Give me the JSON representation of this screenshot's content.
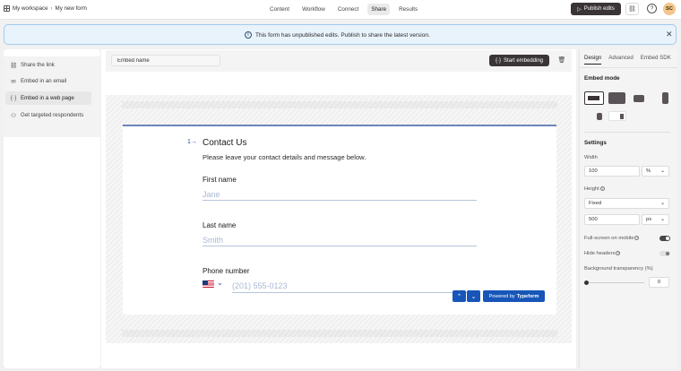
{
  "topbar": {
    "workspace": "My workspace",
    "form_name": "My new form",
    "tabs": [
      "Content",
      "Workflow",
      "Connect",
      "Share",
      "Results"
    ],
    "active_tab": "Share",
    "publish_label": "Publish edits",
    "avatar_initials": "SC"
  },
  "notice": {
    "text": "This form has unpublished edits. Publish to share the latest version."
  },
  "left_menu": {
    "items": [
      {
        "label": "Share the link",
        "icon": "link-icon"
      },
      {
        "label": "Embed in an email",
        "icon": "mail-icon"
      },
      {
        "label": "Embed in a web page",
        "icon": "code-icon"
      },
      {
        "label": "Get targeted respondents",
        "icon": "people-icon"
      }
    ],
    "active": "Embed in a web page"
  },
  "toolbar": {
    "embed_name": "Embed name",
    "start_label": "Start embedding"
  },
  "form": {
    "question_number": "1",
    "title": "Contact Us",
    "description": "Please leave your contact details and message below.",
    "first_name_label": "First name",
    "first_name_placeholder": "Jane",
    "last_name_label": "Last name",
    "last_name_placeholder": "Smith",
    "phone_label": "Phone number",
    "phone_placeholder": "(201) 555-0123",
    "powered_prefix": "Powered by",
    "powered_brand": "Typeform"
  },
  "right_panel": {
    "tabs": [
      "Design",
      "Advanced",
      "Embed SDK"
    ],
    "active_tab": "Design",
    "embed_mode_label": "Embed mode",
    "settings_label": "Settings",
    "width_label": "Width",
    "width_value": "100",
    "width_unit": "%",
    "height_label": "Height",
    "height_mode": "Fixed",
    "height_value": "500",
    "height_unit": "px",
    "fullscreen_label": "Full-screen on mobile",
    "fullscreen_on": true,
    "hide_headers_label": "Hide headers",
    "hide_headers_on": false,
    "bg_transparency_label": "Background transparency (%)",
    "bg_transparency_value": "0"
  },
  "colors": {
    "accent_dark": "#3a3437",
    "form_blue": "#1756b8",
    "notice_bg": "#e9f3fb",
    "avatar_bg": "#f4c58a"
  }
}
